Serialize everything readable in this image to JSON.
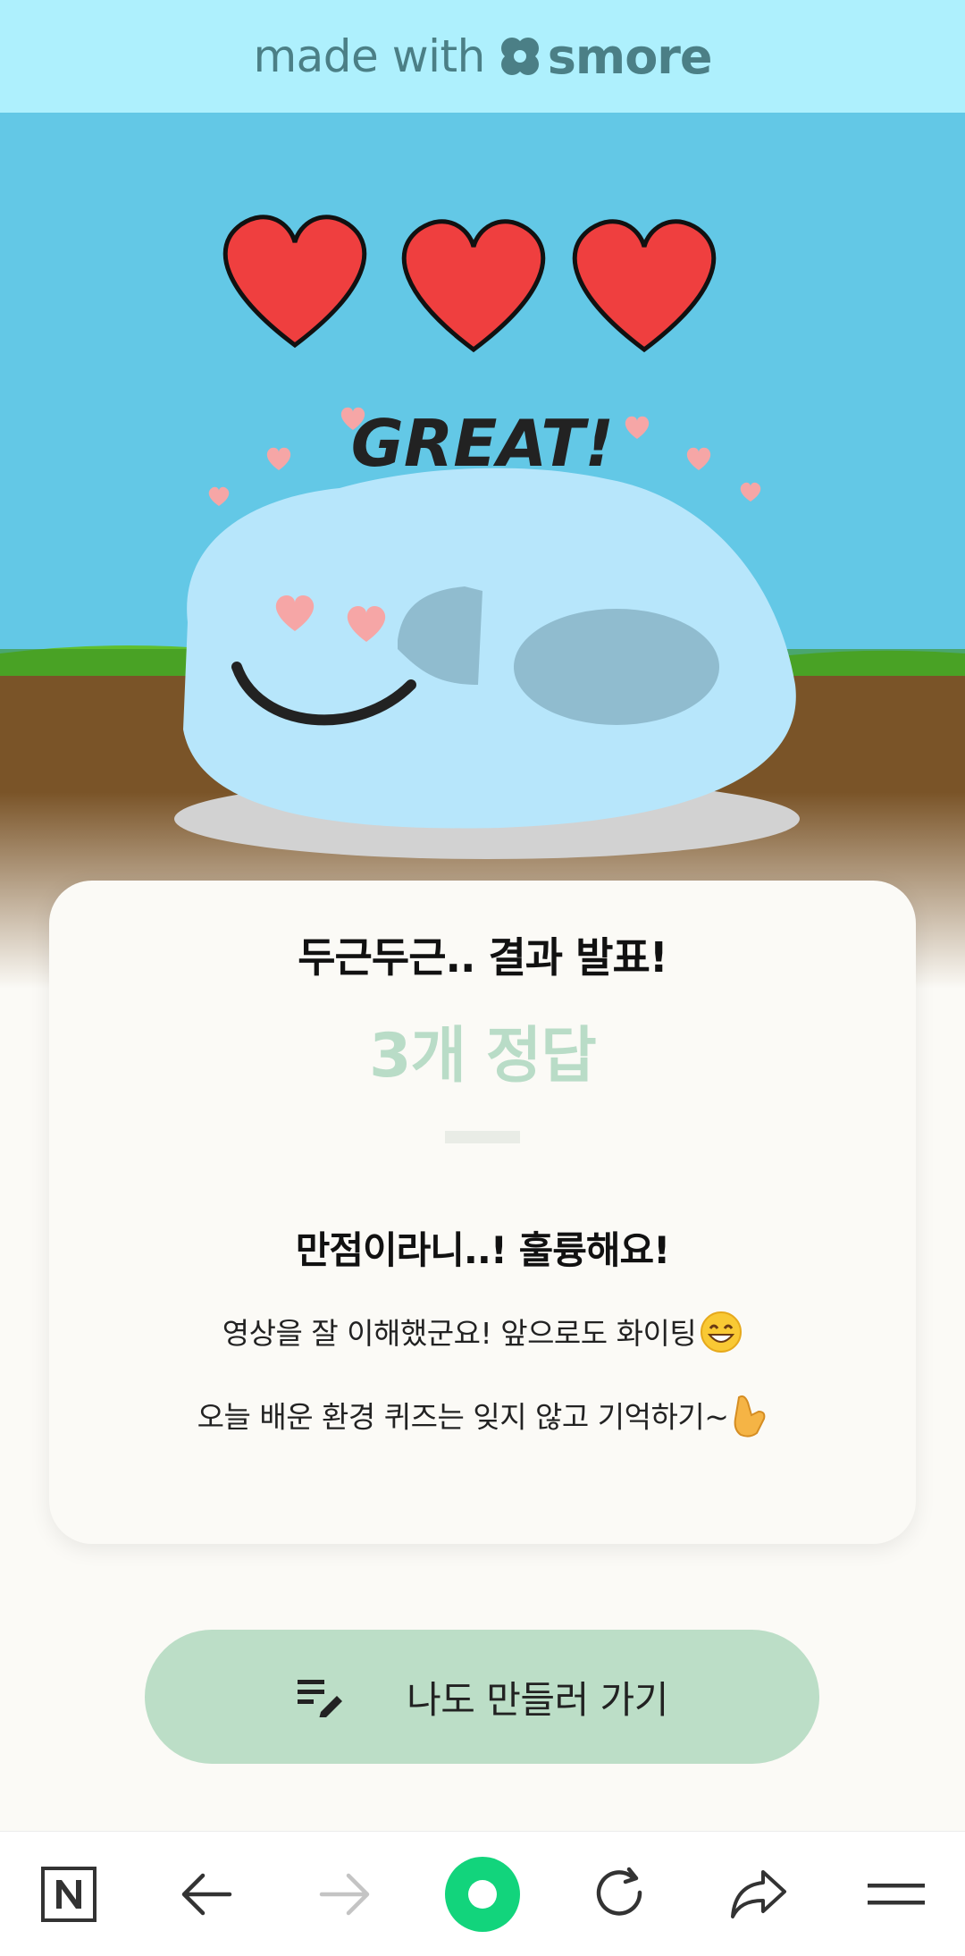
{
  "header": {
    "made_with": "made with",
    "brand": "smore"
  },
  "scene": {
    "great_text": "GREAT!",
    "hearts_count": 3,
    "colors": {
      "sky": "#63c8e6",
      "heart": "#ef3f3f",
      "grass": "#5fbf2e",
      "dirt": "#7a5428",
      "blob": "#b7e6fb"
    }
  },
  "result_card": {
    "title": "두근두근.. 결과 발표!",
    "score": "3개 정답",
    "headline": "만점이라니..! 훌륭해요!",
    "line1": "영상을 잘 이해했군요! 앞으로도 화이팅",
    "line2": "오늘 배운 환경 퀴즈는 잊지 않고 기억하기~"
  },
  "cta": {
    "label": "나도 만들러 가기",
    "icon": "edit-list-icon"
  },
  "bottom_nav": {
    "items": [
      {
        "name": "naver-home",
        "icon": "n-logo-icon"
      },
      {
        "name": "back",
        "icon": "arrow-left-icon"
      },
      {
        "name": "forward",
        "icon": "arrow-right-icon"
      },
      {
        "name": "green-dot",
        "icon": "green-circle-icon"
      },
      {
        "name": "reload",
        "icon": "reload-icon"
      },
      {
        "name": "share",
        "icon": "share-icon"
      },
      {
        "name": "menu",
        "icon": "hamburger-icon"
      }
    ],
    "colors": {
      "icon": "#333333",
      "disabled": "#c4c4c4",
      "accent": "#12d47c"
    }
  }
}
